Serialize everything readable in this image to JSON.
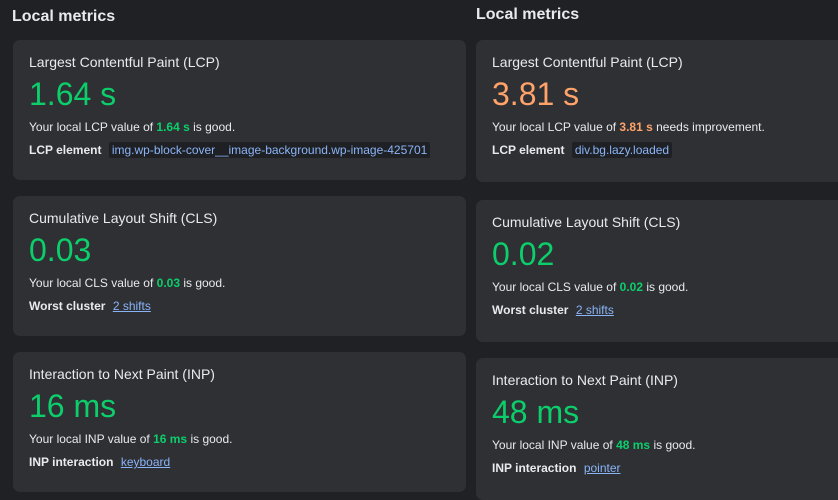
{
  "left": {
    "heading": "Local metrics",
    "lcp": {
      "title": "Largest Contentful Paint (LCP)",
      "value": "1.64 s",
      "desc_prefix": "Your local LCP value of ",
      "desc_value": "1.64 s",
      "desc_suffix": " is good.",
      "detail_label": "LCP element",
      "detail_value": "img.wp-block-cover__image-background.wp-image-425701"
    },
    "cls": {
      "title": "Cumulative Layout Shift (CLS)",
      "value": "0.03",
      "desc_prefix": "Your local CLS value of ",
      "desc_value": "0.03",
      "desc_suffix": " is good.",
      "detail_label": "Worst cluster",
      "detail_value": "2 shifts"
    },
    "inp": {
      "title": "Interaction to Next Paint (INP)",
      "value": "16 ms",
      "desc_prefix": "Your local INP value of ",
      "desc_value": "16 ms",
      "desc_suffix": " is good.",
      "detail_label": "INP interaction",
      "detail_value": "keyboard"
    }
  },
  "right": {
    "heading": "Local metrics",
    "lcp": {
      "title": "Largest Contentful Paint (LCP)",
      "value": "3.81 s",
      "desc_prefix": "Your local LCP value of ",
      "desc_value": "3.81 s",
      "desc_suffix": " needs improvement.",
      "detail_label": "LCP element",
      "detail_value": "div.bg.lazy.loaded"
    },
    "cls": {
      "title": "Cumulative Layout Shift (CLS)",
      "value": "0.02",
      "desc_prefix": "Your local CLS value of ",
      "desc_value": "0.02",
      "desc_suffix": " is good.",
      "detail_label": "Worst cluster",
      "detail_value": "2 shifts"
    },
    "inp": {
      "title": "Interaction to Next Paint (INP)",
      "value": "48 ms",
      "desc_prefix": "Your local INP value of ",
      "desc_value": "48 ms",
      "desc_suffix": " is good.",
      "detail_label": "INP interaction",
      "detail_value": "pointer"
    }
  },
  "colors": {
    "background": "#202124",
    "card": "#2e3034",
    "good": "#0cce6b",
    "needs_improvement": "#ffa36a",
    "link": "#8ab4f8"
  }
}
